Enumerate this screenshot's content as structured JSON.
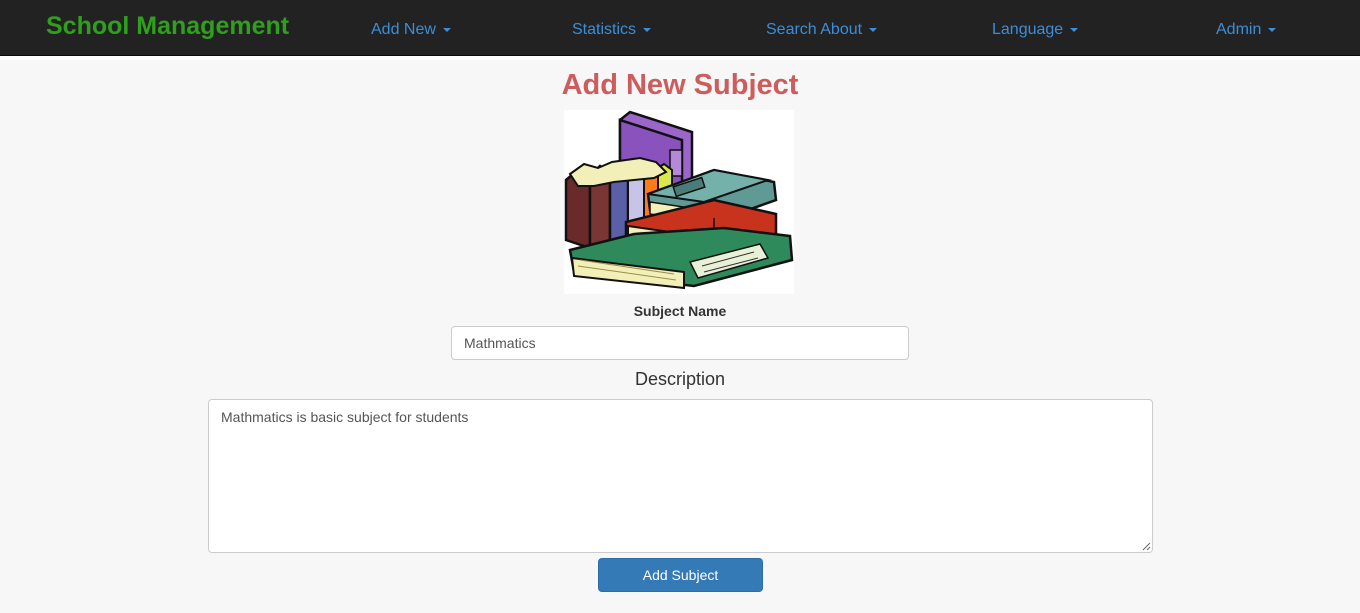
{
  "header": {
    "brand": "School Management",
    "menu": [
      {
        "label": "Add New"
      },
      {
        "label": "Statistics"
      },
      {
        "label": "Search About"
      },
      {
        "label": "Language"
      },
      {
        "label": "Admin"
      }
    ]
  },
  "main": {
    "title": "Add New Subject",
    "image": "books-stack-icon",
    "subject_name_label": "Subject Name",
    "subject_name_value": "Mathmatics",
    "description_label": "Description",
    "description_value": "Mathmatics is basic subject for students",
    "submit_label": "Add Subject"
  },
  "colors": {
    "brand": "#2ea01c",
    "nav_link": "#3b8ed8",
    "title": "#cd5c5c",
    "primary_button": "#337ab7"
  }
}
